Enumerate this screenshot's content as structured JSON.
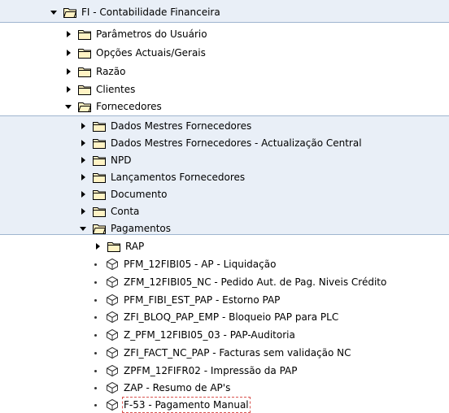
{
  "tree": {
    "root": {
      "label": "FI - Contabilidade Financeira",
      "expanded": true
    },
    "level1": [
      {
        "label": "Parâmetros do Usuário",
        "expanded": false
      },
      {
        "label": "Opções Actuais/Gerais",
        "expanded": false
      },
      {
        "label": "Razão",
        "expanded": false
      },
      {
        "label": "Clientes",
        "expanded": false
      },
      {
        "label": "Fornecedores",
        "expanded": true
      }
    ],
    "fornecedores": [
      {
        "label": "Dados Mestres Fornecedores",
        "expanded": false
      },
      {
        "label": "Dados Mestres Fornecedores - Actualização Central",
        "expanded": false
      },
      {
        "label": "NPD",
        "expanded": false
      },
      {
        "label": "Lançamentos Fornecedores",
        "expanded": false
      },
      {
        "label": "Documento",
        "expanded": false
      },
      {
        "label": "Conta",
        "expanded": false
      },
      {
        "label": "Pagamentos",
        "expanded": true
      }
    ],
    "pagamentos": [
      {
        "label": "RAP",
        "type": "folder"
      },
      {
        "label": "PFM_12FIBI05 - AP - Liquidação",
        "type": "transaction"
      },
      {
        "label": "ZFM_12FIBI05_NC - Pedido Aut. de Pag. Niveis Crédito",
        "type": "transaction"
      },
      {
        "label": "PFM_FIBI_EST_PAP - Estorno PAP",
        "type": "transaction"
      },
      {
        "label": "ZFI_BLOQ_PAP_EMP - Bloqueio PAP para PLC",
        "type": "transaction"
      },
      {
        "label": "Z_PFM_12FIBI05_03 - PAP-Auditoria",
        "type": "transaction"
      },
      {
        "label": "ZFI_FACT_NC_PAP - Facturas sem validação NC",
        "type": "transaction"
      },
      {
        "label": "ZPFM_12FIFR02 - Impressão da PAP",
        "type": "transaction"
      },
      {
        "label": "ZAP - Resumo de AP's",
        "type": "transaction"
      },
      {
        "label": "F-53 - Pagamento Manual",
        "type": "transaction",
        "focused": true
      }
    ]
  },
  "colors": {
    "band_blue": "#e9eff7",
    "separator": "#9fb5cf",
    "folder_fill": "#fff3c4",
    "folder_stroke": "#000000",
    "focus_outline": "#d9534f"
  },
  "icons": {
    "expand": "triangle-right-icon",
    "collapse": "triangle-down-icon",
    "folder": "folder-icon",
    "open_folder": "open-folder-icon",
    "transaction": "transaction-cube-icon",
    "leaf": "bullet-icon"
  }
}
